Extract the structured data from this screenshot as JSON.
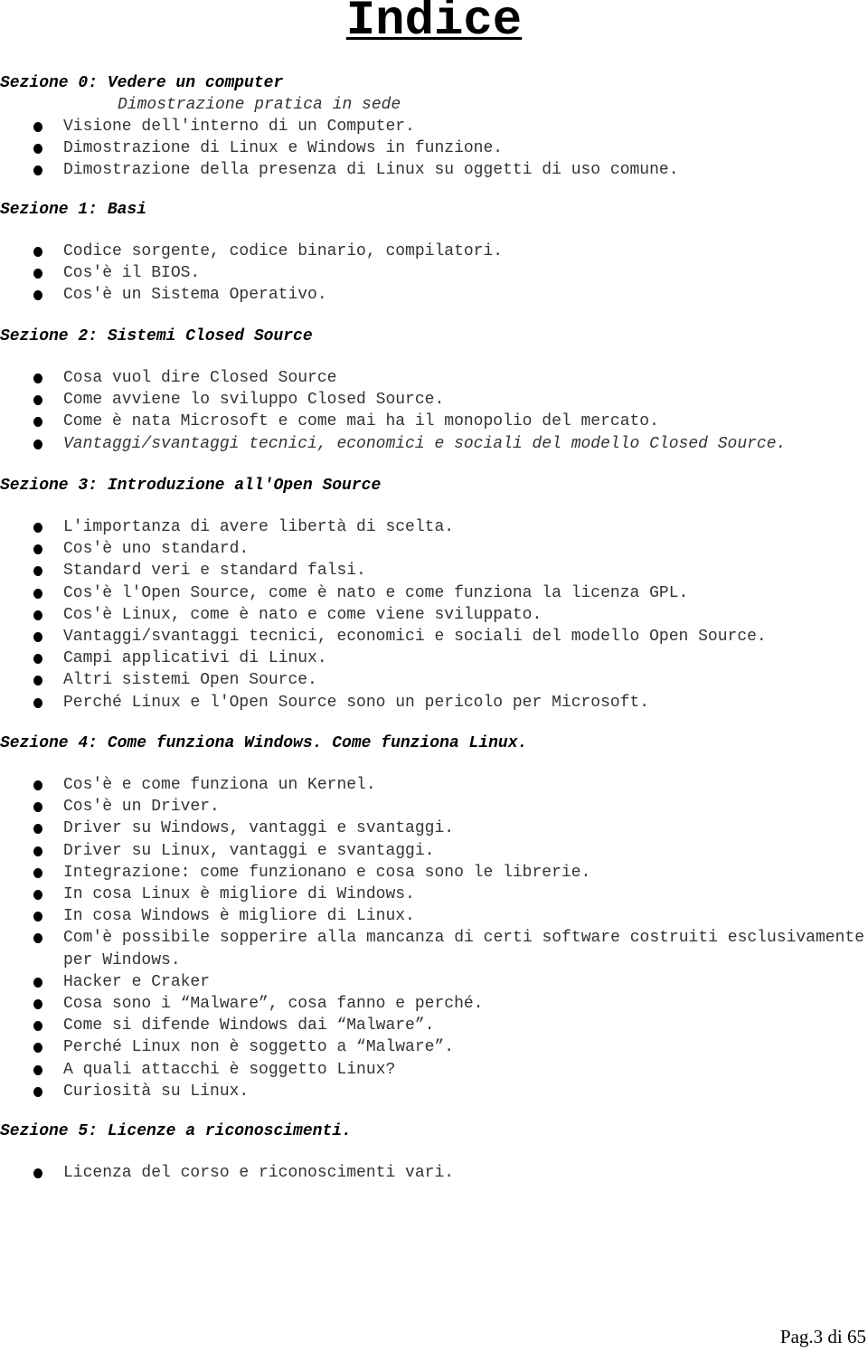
{
  "page_title": "Indice",
  "sections": [
    {
      "heading": "Sezione 0: Vedere un computer",
      "subheading": "Dimostrazione pratica in sede",
      "items": [
        "Visione dell'interno di un Computer.",
        "Dimostrazione di Linux e Windows in funzione.",
        "Dimostrazione della presenza di Linux su oggetti di uso comune."
      ]
    },
    {
      "heading": "Sezione 1: Basi",
      "items": [
        "Codice sorgente, codice binario, compilatori.",
        "Cos'è il BIOS.",
        "Cos'è un Sistema Operativo."
      ]
    },
    {
      "heading": "Sezione 2: Sistemi Closed Source",
      "items": [
        "Cosa vuol dire Closed Source",
        "Come avviene lo sviluppo Closed Source.",
        "Come è nata Microsoft e come mai ha il monopolio del mercato.",
        "Vantaggi/svantaggi tecnici, economici e sociali del modello Closed Source."
      ]
    },
    {
      "heading": "Sezione 3: Introduzione all'Open Source",
      "items": [
        "L'importanza di avere libertà di scelta.",
        "Cos'è uno standard.",
        "Standard veri e standard falsi.",
        "Cos'è l'Open Source, come è nato e come funziona la licenza GPL.",
        "Cos'è Linux, come è nato e come viene sviluppato.",
        "Vantaggi/svantaggi tecnici, economici e sociali del modello Open Source.",
        "Campi applicativi di Linux.",
        "Altri sistemi Open Source.",
        "Perché Linux e l'Open Source sono un pericolo per Microsoft."
      ]
    },
    {
      "heading": "Sezione 4: Come funziona Windows. Come funziona Linux.",
      "items": [
        "Cos'è e come funziona un Kernel.",
        "Cos'è un Driver.",
        "Driver su Windows, vantaggi e svantaggi.",
        "Driver su Linux, vantaggi e svantaggi.",
        "Integrazione: come funzionano e cosa sono le librerie.",
        "In cosa Linux è migliore di Windows.",
        "In cosa Windows è migliore di Linux.",
        "Com'è possibile sopperire alla mancanza di certi software costruiti esclusivamente per Windows.",
        "Hacker e Craker",
        "Cosa sono i “Malware”, cosa fanno e perché.",
        "Come si difende Windows dai “Malware”.",
        "Perché Linux non è soggetto a “Malware”.",
        "A quali attacchi è soggetto Linux?",
        "Curiosità su Linux."
      ]
    },
    {
      "heading": "Sezione 5: Licenze a riconoscimenti.",
      "items": [
        "Licenza del corso e riconoscimenti vari."
      ]
    }
  ],
  "footer": {
    "page_label": "Pag.3 di 65"
  }
}
